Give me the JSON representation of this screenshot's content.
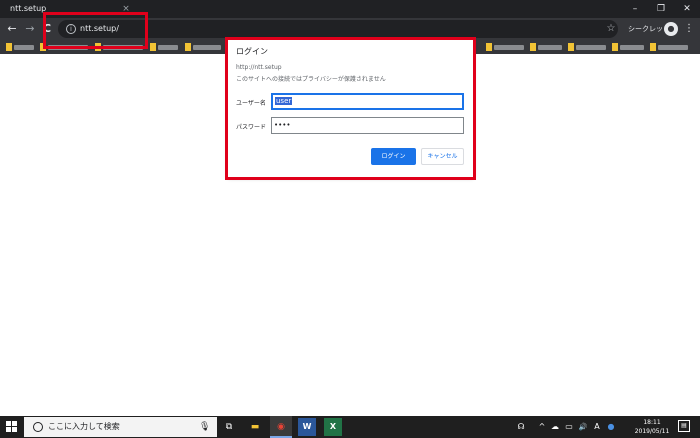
{
  "window": {
    "tab_title": "ntt.setup",
    "tab_close": "×",
    "minimize": "–",
    "restore": "❐",
    "close": "✕"
  },
  "toolbar": {
    "back": "←",
    "forward": "→",
    "reload": "C",
    "info": "i",
    "url": "ntt.setup/",
    "star": "☆",
    "incognito_label": "シークレット",
    "incognito_glyph": "●",
    "menu": "⋮"
  },
  "dialog": {
    "title": "ログイン",
    "origin": "http://ntt.setup",
    "warning": "このサイトへの接続ではプライバシーが保護されません",
    "username_label": "ユーザー名",
    "username_value": "user",
    "password_label": "パスワード",
    "password_value": "••••",
    "login_button": "ログイン",
    "cancel_button": "キャンセル"
  },
  "taskbar": {
    "search_text": "ここに入力して検索",
    "mic": "🎙",
    "taskview": "⧉",
    "explorer": "▬",
    "chrome": "◉",
    "word": "W",
    "excel": "X",
    "people": "☊",
    "chevron": "^",
    "tray_cloud": "☁",
    "tray_network": "▭",
    "tray_volume": "🔊",
    "tray_ime": "A",
    "tray_dot": "●",
    "time": "18:11",
    "date": "2019/05/11",
    "notifications": "▤"
  },
  "colors": {
    "highlight": "#e0001b",
    "primary": "#1a73e8",
    "chrome_dark": "#202124"
  }
}
